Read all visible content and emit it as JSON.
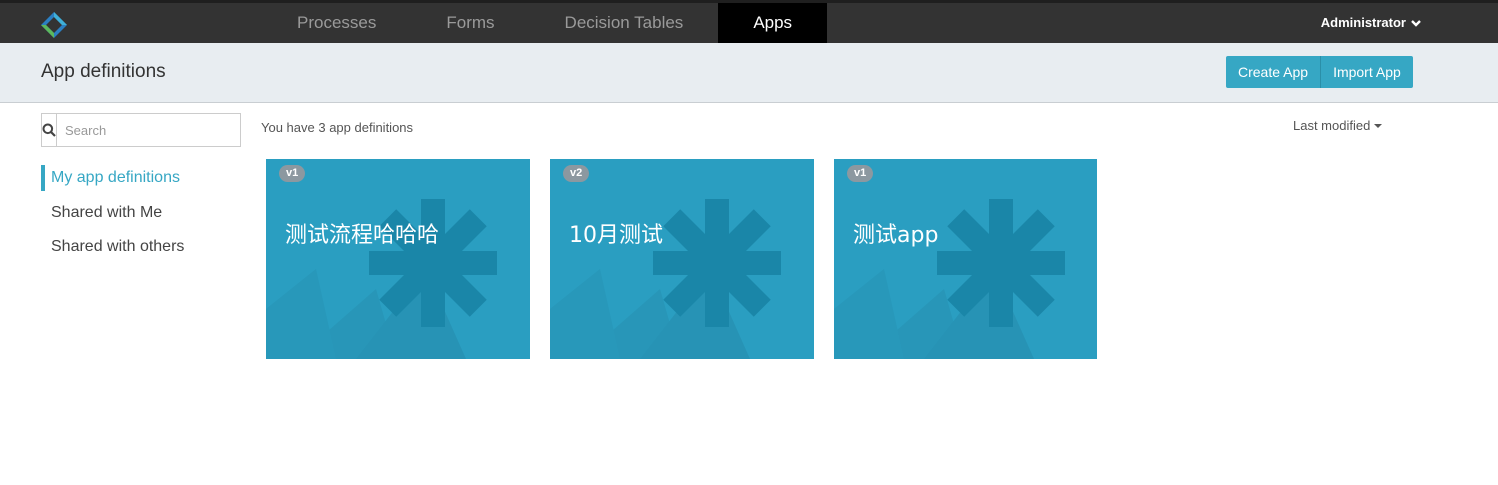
{
  "navbar": {
    "tabs": [
      {
        "label": "Processes",
        "active": false
      },
      {
        "label": "Forms",
        "active": false
      },
      {
        "label": "Decision Tables",
        "active": false
      },
      {
        "label": "Apps",
        "active": true
      }
    ],
    "user": "Administrator",
    "user_icon": "chevron-down-icon"
  },
  "header": {
    "title": "App definitions",
    "create_label": "Create App",
    "import_label": "Import App"
  },
  "sidebar": {
    "search_placeholder": "Search",
    "search_value": "",
    "items": [
      {
        "label": "My app definitions",
        "active": true
      },
      {
        "label": "Shared with Me",
        "active": false
      },
      {
        "label": "Shared with others",
        "active": false
      }
    ]
  },
  "main": {
    "summary": "You have 3 app definitions",
    "sort_label": "Last modified",
    "cards": [
      {
        "version": "v1",
        "title": "测试流程哈哈哈"
      },
      {
        "version": "v2",
        "title": "10月测试"
      },
      {
        "version": "v1",
        "title": "测试app"
      }
    ]
  },
  "colors": {
    "accent": "#36a7c4",
    "card": "#2a9ec1",
    "navbar": "#333333"
  }
}
